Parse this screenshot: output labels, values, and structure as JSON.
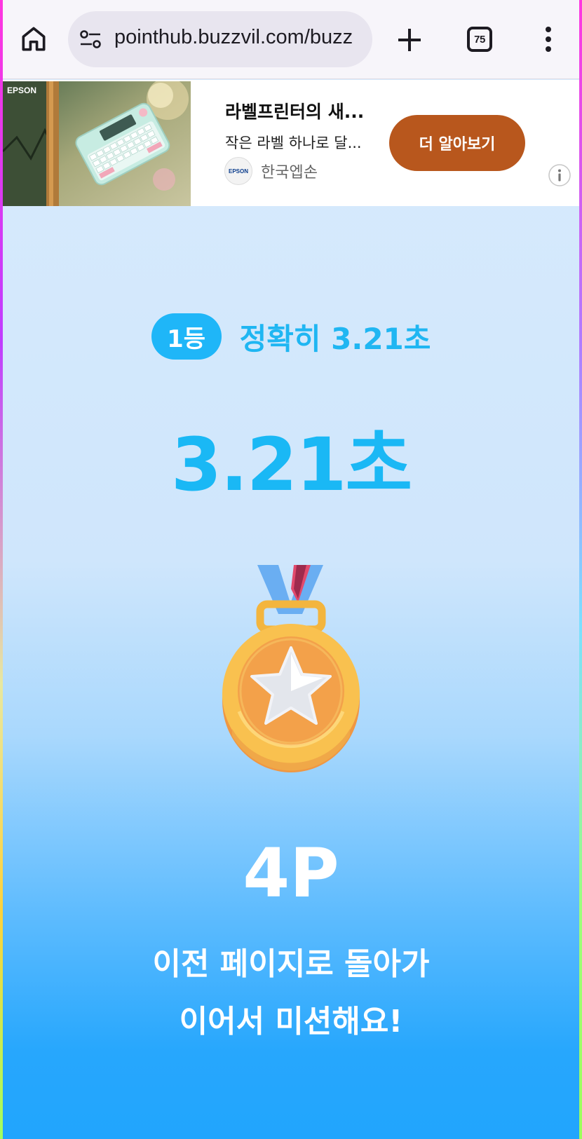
{
  "browser": {
    "url": "pointhub.buzzvil.com/buzz",
    "tab_count": "75",
    "icons": {
      "home": "home-icon",
      "site_settings": "tune-icon",
      "new_tab": "plus-icon",
      "tabs": "tab-switcher-icon",
      "menu": "more-vert-icon"
    }
  },
  "ad": {
    "image_brand": "EPSON",
    "title": "라벨프린터의 새...",
    "description": "작은 라벨 하나로 달...",
    "advertiser_logo": "EPSON",
    "advertiser": "한국엡손",
    "cta": "더 알아보기",
    "cta_color": "#b8571d",
    "info_icon": "info-icon"
  },
  "result": {
    "rank_badge": "1등",
    "target": "정확히 3.21초",
    "time": "3.21초",
    "medal_icon": "gold-medal-icon",
    "points": "4P",
    "message_line1": "이전 페이지로 돌아가",
    "message_line2": "이어서 미션해요!",
    "accent_color": "#1fb6f2"
  }
}
